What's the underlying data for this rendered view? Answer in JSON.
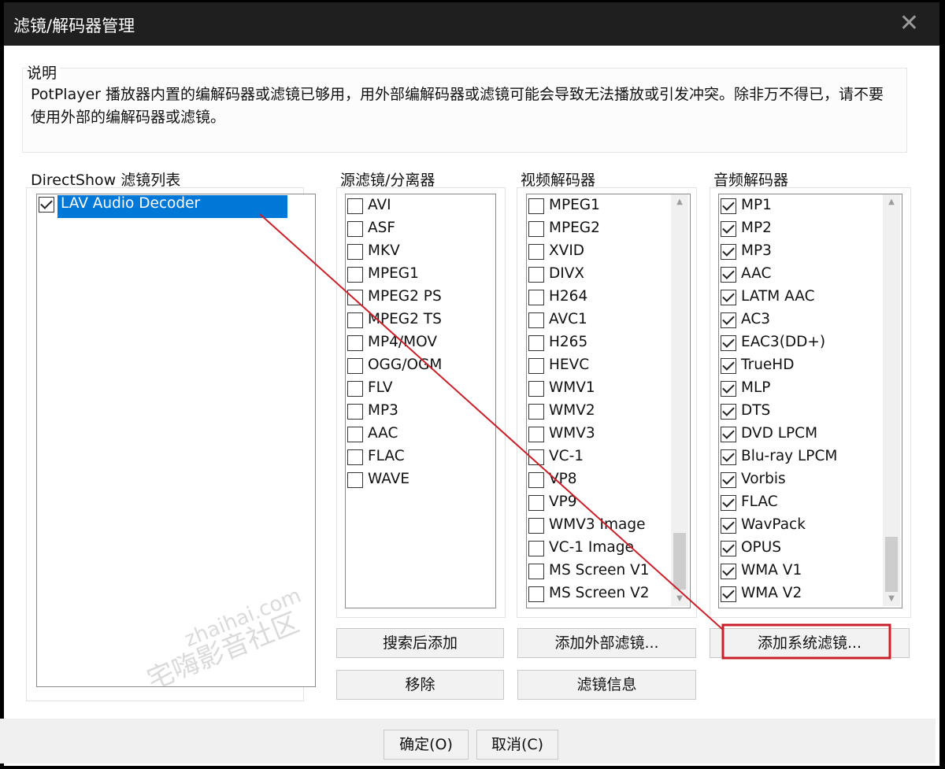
{
  "window": {
    "title": "滤镜/解码器管理",
    "close_glyph": "✕"
  },
  "description": {
    "label": "说明",
    "text": "PotPlayer 播放器内置的编解码器或滤镜已够用，用外部编解码器或滤镜可能会导致无法播放或引发冲突。除非万不得已，请不要使用外部的编解码器或滤镜。"
  },
  "directshow": {
    "label": "DirectShow 滤镜列表",
    "items": [
      {
        "label": "LAV Audio Decoder",
        "checked": true,
        "selected": true
      }
    ]
  },
  "source_filters": {
    "label": "源滤镜/分离器",
    "items": [
      {
        "label": "AVI",
        "checked": false
      },
      {
        "label": "ASF",
        "checked": false
      },
      {
        "label": "MKV",
        "checked": false
      },
      {
        "label": "MPEG1",
        "checked": false
      },
      {
        "label": "MPEG2 PS",
        "checked": false
      },
      {
        "label": "MPEG2 TS",
        "checked": false
      },
      {
        "label": "MP4/MOV",
        "checked": false
      },
      {
        "label": "OGG/OGM",
        "checked": false
      },
      {
        "label": "FLV",
        "checked": false
      },
      {
        "label": "MP3",
        "checked": false
      },
      {
        "label": "AAC",
        "checked": false
      },
      {
        "label": "FLAC",
        "checked": false
      },
      {
        "label": "WAVE",
        "checked": false
      }
    ]
  },
  "video_decoders": {
    "label": "视频解码器",
    "items": [
      {
        "label": "MPEG1",
        "checked": false
      },
      {
        "label": "MPEG2",
        "checked": false
      },
      {
        "label": "XVID",
        "checked": false
      },
      {
        "label": "DIVX",
        "checked": false
      },
      {
        "label": "H264",
        "checked": false
      },
      {
        "label": "AVC1",
        "checked": false
      },
      {
        "label": "H265",
        "checked": false
      },
      {
        "label": "HEVC",
        "checked": false
      },
      {
        "label": "WMV1",
        "checked": false
      },
      {
        "label": "WMV2",
        "checked": false
      },
      {
        "label": "WMV3",
        "checked": false
      },
      {
        "label": "VC-1",
        "checked": false
      },
      {
        "label": "VP8",
        "checked": false
      },
      {
        "label": "VP9",
        "checked": false
      },
      {
        "label": "WMV3 Image",
        "checked": false
      },
      {
        "label": "VC-1 Image",
        "checked": false
      },
      {
        "label": "MS Screen V1",
        "checked": false
      },
      {
        "label": "MS Screen V2",
        "checked": false
      }
    ]
  },
  "audio_decoders": {
    "label": "音频解码器",
    "items": [
      {
        "label": "MP1",
        "checked": true
      },
      {
        "label": "MP2",
        "checked": true
      },
      {
        "label": "MP3",
        "checked": true
      },
      {
        "label": "AAC",
        "checked": true
      },
      {
        "label": "LATM AAC",
        "checked": true
      },
      {
        "label": "AC3",
        "checked": true
      },
      {
        "label": "EAC3(DD+)",
        "checked": true
      },
      {
        "label": "TrueHD",
        "checked": true
      },
      {
        "label": "MLP",
        "checked": true
      },
      {
        "label": "DTS",
        "checked": true
      },
      {
        "label": "DVD LPCM",
        "checked": true
      },
      {
        "label": "Blu-ray LPCM",
        "checked": true
      },
      {
        "label": "Vorbis",
        "checked": true
      },
      {
        "label": "FLAC",
        "checked": true
      },
      {
        "label": "WavPack",
        "checked": true
      },
      {
        "label": "OPUS",
        "checked": true
      },
      {
        "label": "WMA V1",
        "checked": true
      },
      {
        "label": "WMA V2",
        "checked": true
      }
    ]
  },
  "buttons": {
    "search_add": "搜索后添加",
    "remove": "移除",
    "add_external": "添加外部滤镜...",
    "filter_info": "滤镜信息",
    "add_system": "添加系统滤镜..."
  },
  "footer": {
    "ok": "确定(O)",
    "cancel": "取消(C)"
  },
  "watermark": {
    "site": "zhaihai.com",
    "name": "宅嗨影音社区"
  },
  "colors": {
    "selection": "#0078d7",
    "annotation": "#c8202a",
    "titlebar": "#1f1f1f"
  }
}
